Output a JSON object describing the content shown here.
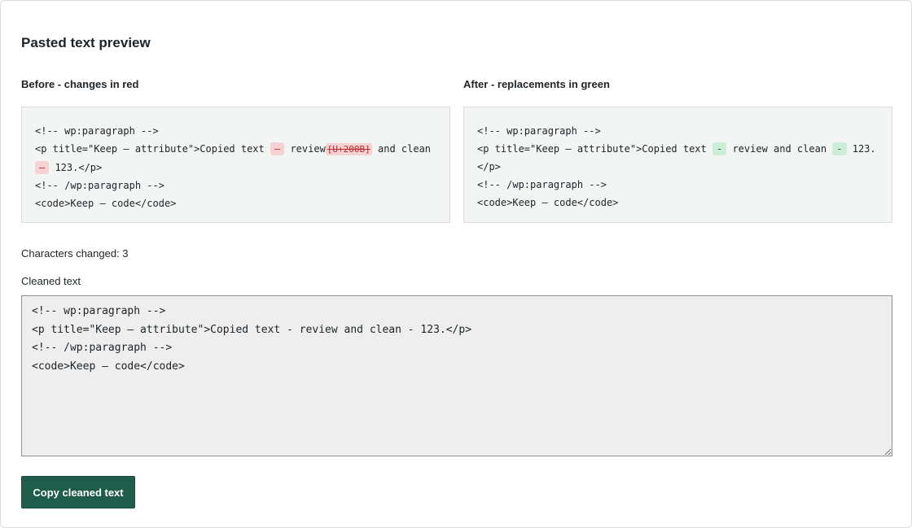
{
  "page": {
    "title": "Pasted text preview"
  },
  "before": {
    "heading": "Before - changes in red",
    "line1": "<!-- wp:paragraph -->",
    "line2_a": "<p title=\"Keep — attribute\">Copied text ",
    "line2_mark1": "—",
    "line2_b": " review",
    "line2_mark2": "[U+200B]",
    "line2_c": " and clean",
    "line3_mark": "—",
    "line3_b": " 123.</p>",
    "line4": "<!-- /wp:paragraph -->",
    "line5": "<code>Keep — code</code>"
  },
  "after": {
    "heading": "After - replacements in green",
    "line1": "<!-- wp:paragraph -->",
    "line2_a": "<p title=\"Keep — attribute\">Copied text ",
    "line2_mark1": "-",
    "line2_b": " review and clean ",
    "line2_mark2": "-",
    "line2_c": " 123.",
    "line3": "</p>",
    "line4": "<!-- /wp:paragraph -->",
    "line5": "<code>Keep — code</code>"
  },
  "stats": {
    "chars_changed": "Characters changed: 3"
  },
  "cleaned": {
    "label": "Cleaned text",
    "value": "<!-- wp:paragraph -->\n<p title=\"Keep — attribute\">Copied text - review and clean - 123.</p>\n<!-- /wp:paragraph -->\n<code>Keep — code</code>"
  },
  "actions": {
    "copy_label": "Copy cleaned text"
  },
  "colors": {
    "removed_bg": "#f8d2d2",
    "added_bg": "#cdeed6",
    "button_bg": "#1f5c4a"
  }
}
